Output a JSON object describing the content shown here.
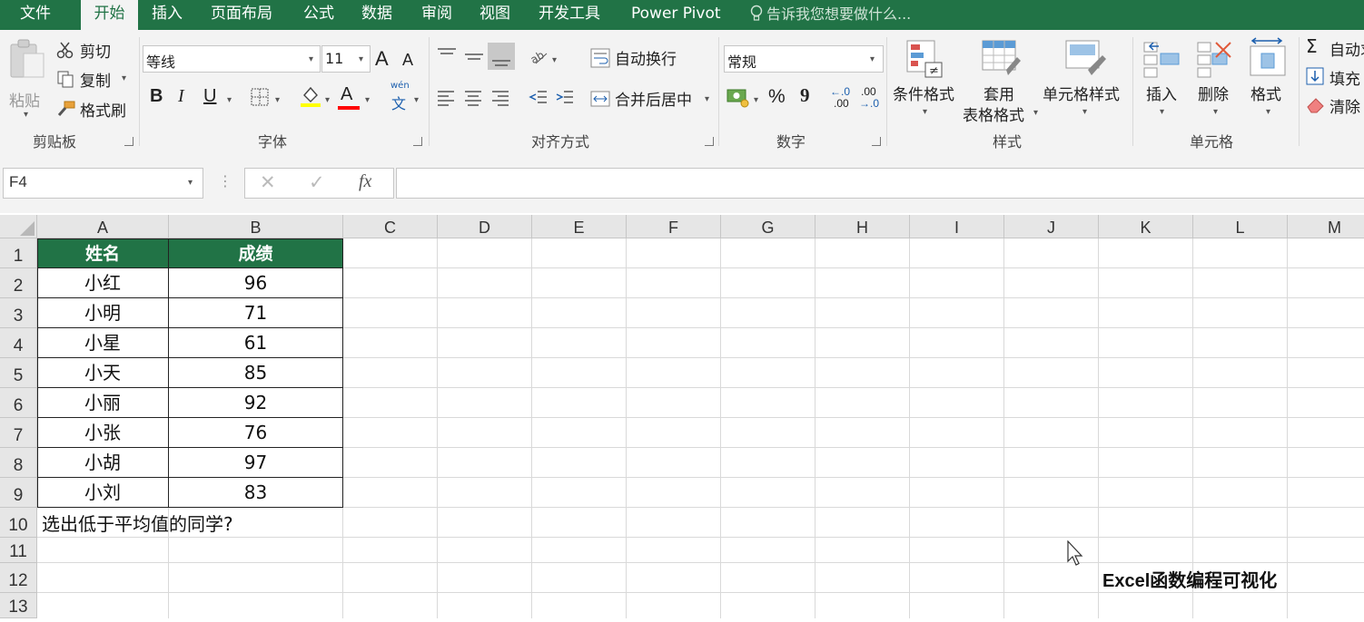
{
  "menu": {
    "tabs": [
      "文件",
      "开始",
      "插入",
      "页面布局",
      "公式",
      "数据",
      "审阅",
      "视图",
      "开发工具",
      "Power Pivot"
    ],
    "active_tab": "开始",
    "tell_me": "告诉我您想要做什么..."
  },
  "ribbon": {
    "clipboard": {
      "paste": "粘贴",
      "cut": "剪切",
      "copy": "复制",
      "format_painter": "格式刷",
      "label": "剪贴板"
    },
    "font": {
      "name": "等线",
      "size": "11",
      "grow": "A",
      "shrink": "A",
      "bold": "B",
      "italic": "I",
      "underline": "U",
      "font_color": "A",
      "phonetic_top": "wén",
      "phonetic": "文",
      "label": "字体"
    },
    "alignment": {
      "wrap": "自动换行",
      "merge": "合并后居中",
      "label": "对齐方式"
    },
    "number": {
      "format": "常规",
      "percent": "%",
      "comma": "9",
      "inc_top": "←.0",
      "inc_bottom": ".00",
      "dec_top": ".00",
      "dec_bottom": "→.0",
      "label": "数字"
    },
    "styles": {
      "conditional": "条件格式",
      "table_line1": "套用",
      "table_line2": "表格格式",
      "cell_styles": "单元格样式",
      "label": "样式"
    },
    "cells": {
      "insert": "插入",
      "delete": "删除",
      "format": "格式",
      "label": "单元格"
    },
    "editing": {
      "autosum": "自动求",
      "fill": "填充",
      "clear": "清除"
    }
  },
  "formula_bar": {
    "name_box": "F4",
    "cancel": "✕",
    "enter": "✓",
    "fx": "fx",
    "formula": ""
  },
  "sheet": {
    "columns": [
      "A",
      "B",
      "C",
      "D",
      "E",
      "F",
      "G",
      "H",
      "I",
      "J",
      "K",
      "L",
      "M"
    ],
    "rows": [
      "1",
      "2",
      "3",
      "4",
      "5",
      "6",
      "7",
      "8",
      "9",
      "10",
      "11",
      "12",
      "13"
    ],
    "header": {
      "name": "姓名",
      "score": "成绩"
    },
    "records": [
      {
        "name": "小红",
        "score": "96"
      },
      {
        "name": "小明",
        "score": "71"
      },
      {
        "name": "小星",
        "score": "61"
      },
      {
        "name": "小天",
        "score": "85"
      },
      {
        "name": "小丽",
        "score": "92"
      },
      {
        "name": "小张",
        "score": "76"
      },
      {
        "name": "小胡",
        "score": "97"
      },
      {
        "name": "小刘",
        "score": "83"
      }
    ],
    "question": "选出低于平均值的同学?",
    "watermark": "Excel函数编程可视化"
  },
  "colors": {
    "accent": "#217346",
    "ribbon_bg": "#f3f3f3",
    "header_bg": "#e6e6e6"
  }
}
